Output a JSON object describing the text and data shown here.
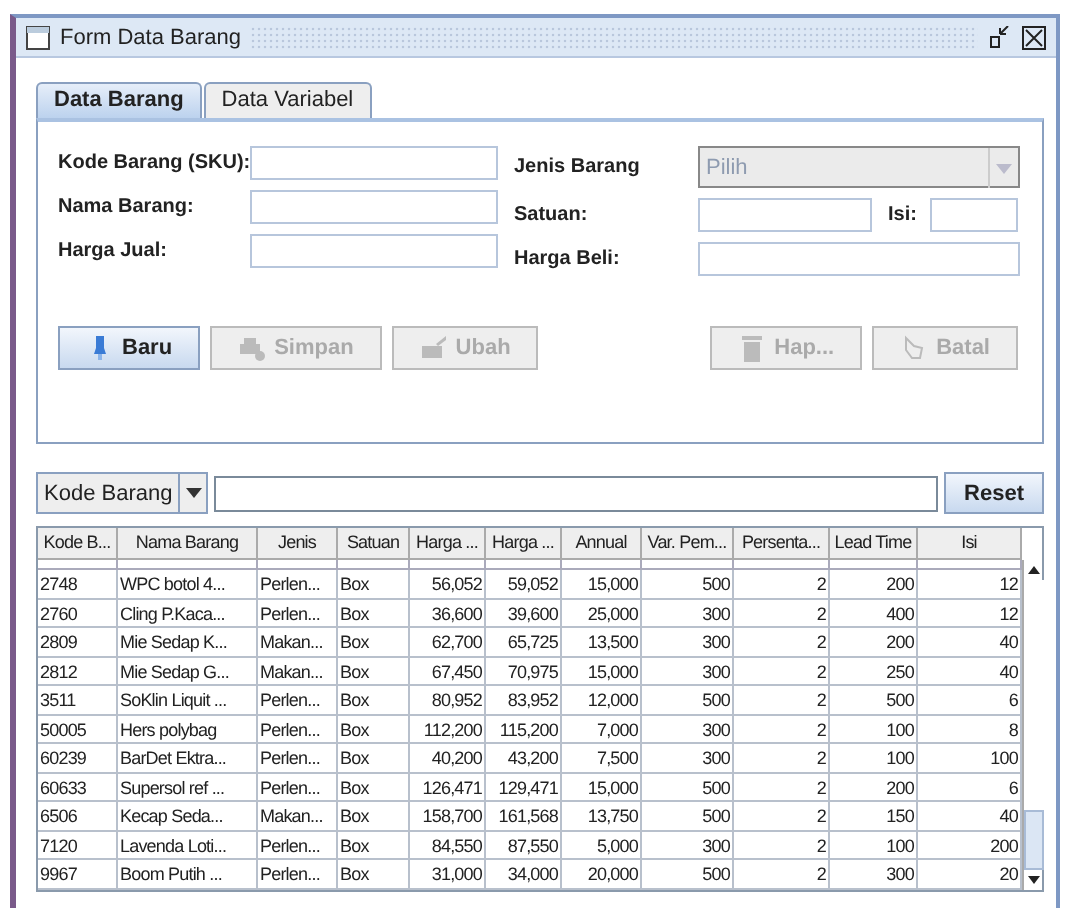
{
  "window": {
    "title": "Form Data Barang"
  },
  "tabs": [
    {
      "label": "Data Barang",
      "selected": true
    },
    {
      "label": "Data Variabel",
      "selected": false
    }
  ],
  "form": {
    "left": [
      {
        "label": "Kode Barang (SKU):"
      },
      {
        "label": "Nama Barang:"
      },
      {
        "label": "Harga Jual:"
      }
    ],
    "jenis": {
      "label": "Jenis Barang",
      "placeholder": "Pilih",
      "disabled": true
    },
    "satuan": {
      "label": "Satuan:"
    },
    "isi": {
      "label": "Isi:"
    },
    "harga_beli": {
      "label": "Harga Beli:"
    }
  },
  "buttons_left": [
    {
      "label": "Baru",
      "disabled": false
    },
    {
      "label": "Simpan",
      "disabled": true
    },
    {
      "label": "Ubah",
      "disabled": true
    }
  ],
  "buttons_right": [
    {
      "label": "Hap...",
      "disabled": true
    },
    {
      "label": "Batal",
      "disabled": true
    }
  ],
  "search": {
    "field": "Kode Barang",
    "button": "Reset"
  },
  "table": {
    "columns": [
      "Kode B...",
      "Nama Barang",
      "Jenis",
      "Satuan",
      "Harga ...",
      "Harga ...",
      "Annual",
      "Var. Pem...",
      "Persenta...",
      "Lead Time",
      "Isi"
    ],
    "rows": [
      [
        "2748",
        "WPC botol 4...",
        "Perlen...",
        "Box",
        "56,052",
        "59,052",
        "15,000",
        "500",
        "2",
        "200",
        "12"
      ],
      [
        "2760",
        "Cling P.Kaca...",
        "Perlen...",
        "Box",
        "36,600",
        "39,600",
        "25,000",
        "300",
        "2",
        "400",
        "12"
      ],
      [
        "2809",
        "Mie Sedap K...",
        "Makan...",
        "Box",
        "62,700",
        "65,725",
        "13,500",
        "300",
        "2",
        "200",
        "40"
      ],
      [
        "2812",
        "Mie Sedap G...",
        "Makan...",
        "Box",
        "67,450",
        "70,975",
        "15,000",
        "300",
        "2",
        "250",
        "40"
      ],
      [
        "3511",
        "SoKlin Liquit ...",
        "Perlen...",
        "Box",
        "80,952",
        "83,952",
        "12,000",
        "500",
        "2",
        "500",
        "6"
      ],
      [
        "50005",
        "Hers polybag",
        "Perlen...",
        "Box",
        "112,200",
        "115,200",
        "7,000",
        "300",
        "2",
        "100",
        "8"
      ],
      [
        "60239",
        "BarDet Ektra...",
        "Perlen...",
        "Box",
        "40,200",
        "43,200",
        "7,500",
        "300",
        "2",
        "100",
        "100"
      ],
      [
        "60633",
        "Supersol ref ...",
        "Perlen...",
        "Box",
        "126,471",
        "129,471",
        "15,000",
        "500",
        "2",
        "200",
        "6"
      ],
      [
        "6506",
        "Kecap Seda...",
        "Makan...",
        "Box",
        "158,700",
        "161,568",
        "13,750",
        "500",
        "2",
        "150",
        "40"
      ],
      [
        "7120",
        "Lavenda Loti...",
        "Perlen...",
        "Box",
        "84,550",
        "87,550",
        "5,000",
        "300",
        "2",
        "100",
        "200"
      ],
      [
        "9967",
        "Boom Putih ...",
        "Perlen...",
        "Box",
        "31,000",
        "34,000",
        "20,000",
        "500",
        "2",
        "300",
        "20"
      ]
    ]
  }
}
